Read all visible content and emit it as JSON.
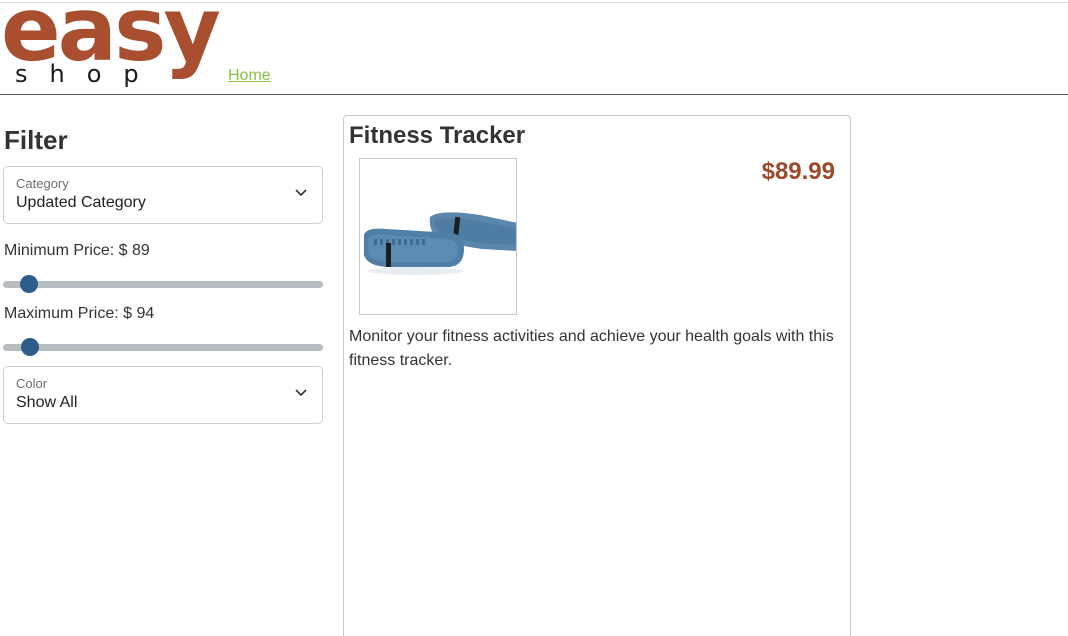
{
  "brand": {
    "logo_top": "easy",
    "logo_bottom": "shop"
  },
  "nav": {
    "home_label": "Home"
  },
  "filter": {
    "title": "Filter",
    "category": {
      "label": "Category",
      "value": "Updated Category"
    },
    "min_price": {
      "label": "Minimum Price: $ 89",
      "value": 89
    },
    "max_price": {
      "label": "Maximum Price: $ 94",
      "value": 94
    },
    "color": {
      "label": "Color",
      "value": "Show All"
    }
  },
  "product": {
    "name": "Fitness Tracker",
    "price": "$89.99",
    "description": "Monitor your fitness activities and achieve your health goals with this fitness tracker.",
    "image_icon": "fitness-band-image"
  },
  "colors": {
    "brand": "#a94e2e",
    "price": "#9c4a2b",
    "link": "#8bc34a",
    "slider_thumb": "#2f5d8a",
    "slider_track": "#b6bec3"
  }
}
